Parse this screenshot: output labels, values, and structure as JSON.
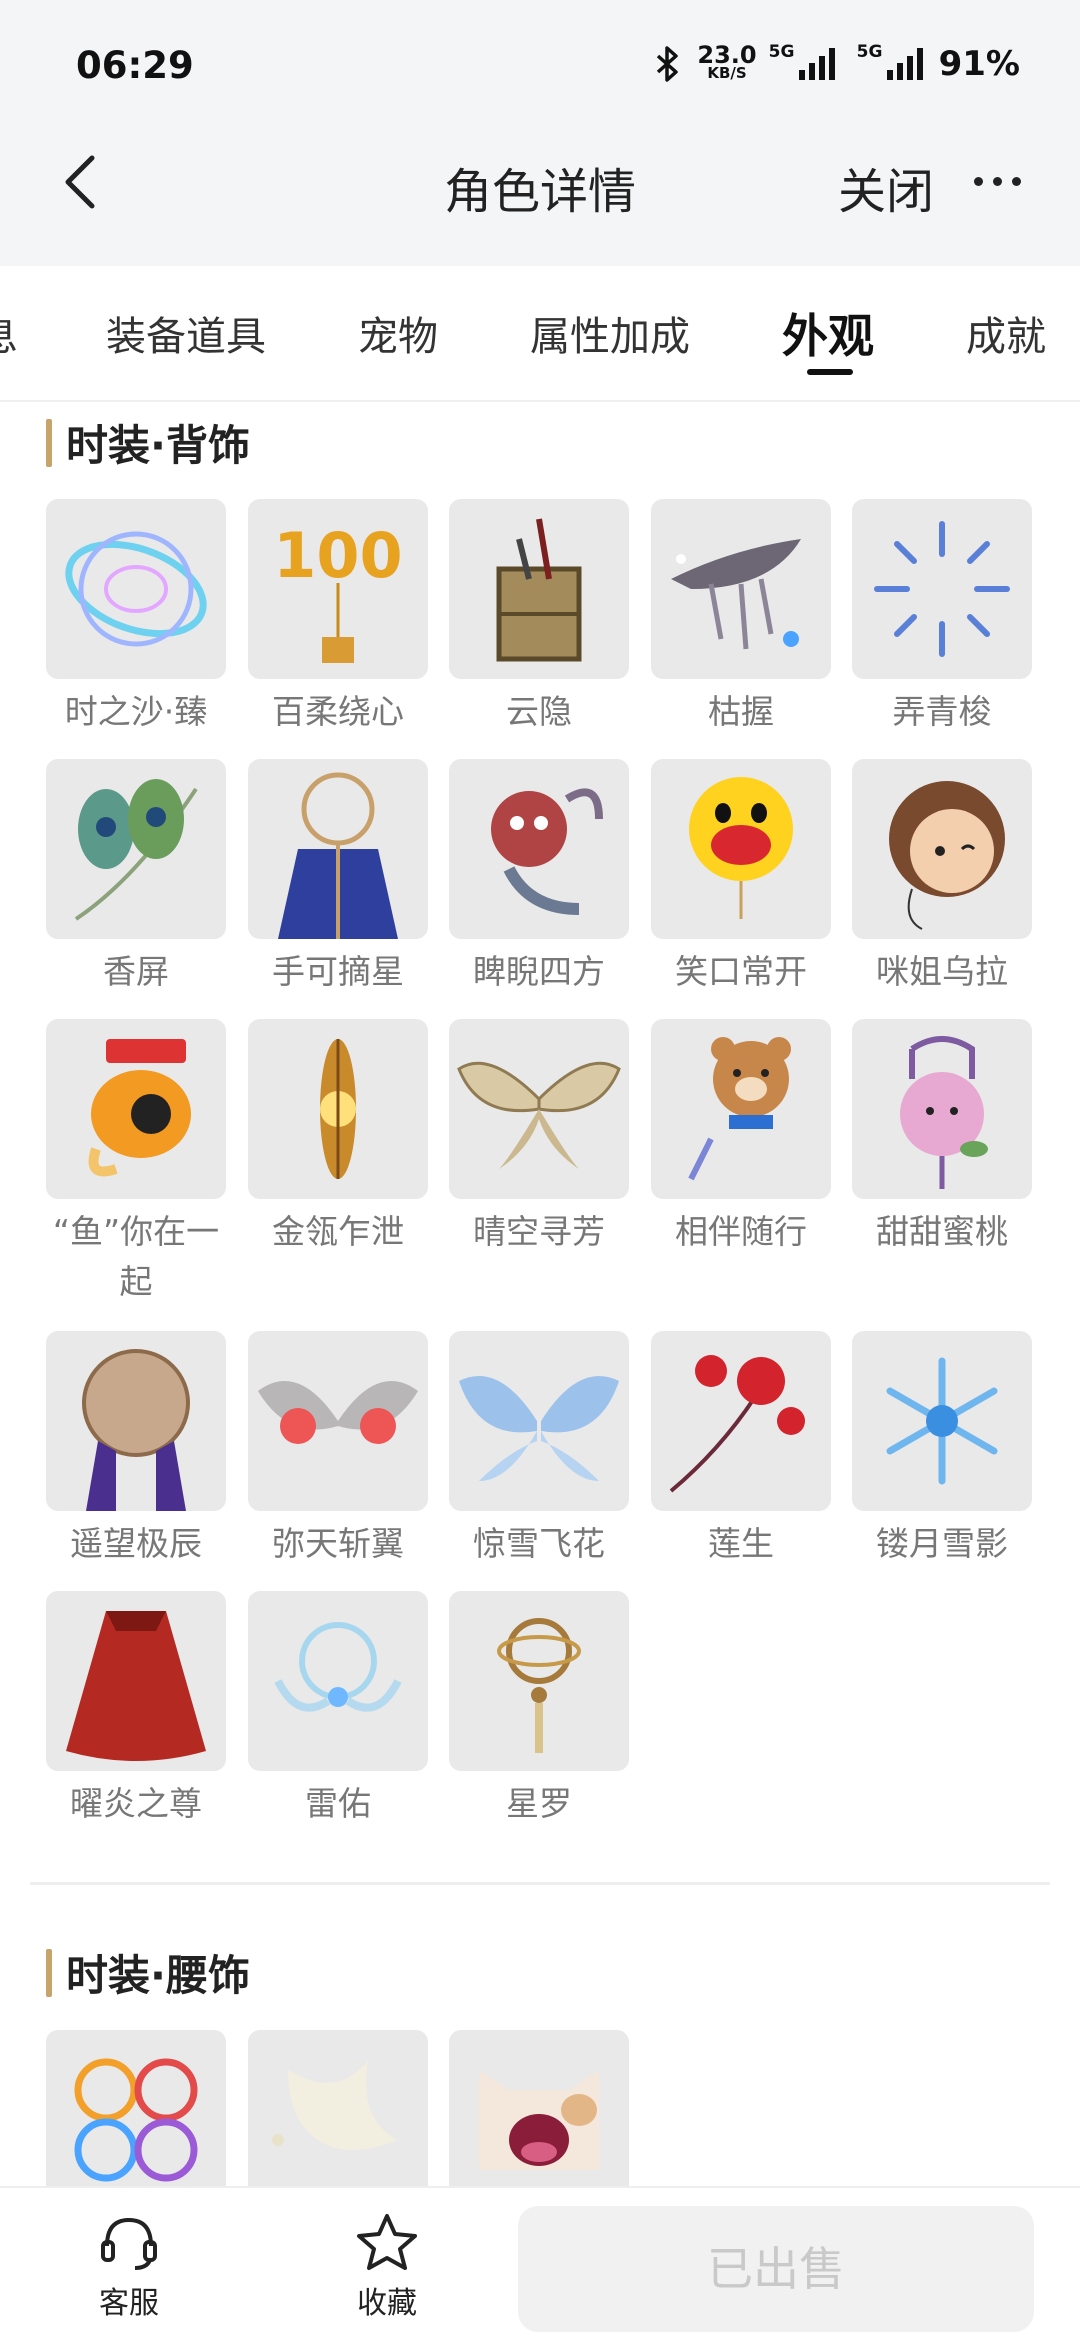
{
  "status_bar": {
    "time": "06:29",
    "net_speed_value": "23.0",
    "net_speed_unit": "KB/S",
    "sim1_type": "5G",
    "sim2_type": "5G",
    "battery": "91%"
  },
  "header": {
    "title": "角色详情",
    "close_label": "关闭"
  },
  "tabs": [
    {
      "label": "息"
    },
    {
      "label": "装备道具"
    },
    {
      "label": "宠物"
    },
    {
      "label": "属性加成"
    },
    {
      "label": "外观",
      "active": true
    },
    {
      "label": "成就"
    }
  ],
  "sections": [
    {
      "title": "时装·背饰",
      "items": [
        {
          "name": "时之沙·臻",
          "icon": "ring-icon"
        },
        {
          "name": "百柔绕心",
          "icon": "balloon-100-icon"
        },
        {
          "name": "云隐",
          "icon": "basket-icon"
        },
        {
          "name": "枯握",
          "icon": "branch-icon"
        },
        {
          "name": "弄青梭",
          "icon": "sparkle-ring-icon"
        },
        {
          "name": "香屏",
          "icon": "peacock-feather-icon"
        },
        {
          "name": "手可摘星",
          "icon": "dreamcatcher-cape-icon"
        },
        {
          "name": "睥睨四方",
          "icon": "demon-icon"
        },
        {
          "name": "笑口常开",
          "icon": "smiley-balloon-icon"
        },
        {
          "name": "咪姐乌拉",
          "icon": "girl-balloon-icon"
        },
        {
          "name": "“鱼”你在一起",
          "icon": "fish-icon"
        },
        {
          "name": "金瓴乍泄",
          "icon": "golden-feather-icon"
        },
        {
          "name": "晴空寻芳",
          "icon": "butterfly-wings-icon"
        },
        {
          "name": "相伴随行",
          "icon": "bear-balloon-icon"
        },
        {
          "name": "甜甜蜜桃",
          "icon": "peach-icon"
        },
        {
          "name": "遥望极辰",
          "icon": "moon-cape-icon"
        },
        {
          "name": "弥天斩翼",
          "icon": "red-wings-icon"
        },
        {
          "name": "惊雪飞花",
          "icon": "blue-wings-icon"
        },
        {
          "name": "莲生",
          "icon": "red-flower-icon"
        },
        {
          "name": "镂月雪影",
          "icon": "snowflake-icon"
        },
        {
          "name": "曜炎之尊",
          "icon": "red-cape-icon"
        },
        {
          "name": "雷佑",
          "icon": "halo-icon"
        },
        {
          "name": "星罗",
          "icon": "astrolabe-icon"
        }
      ]
    },
    {
      "title": "时装·腰饰",
      "items": [
        {
          "name": "",
          "icon": "rings-icon"
        },
        {
          "name": "",
          "icon": "dove-icon"
        },
        {
          "name": "",
          "icon": "cat-icon"
        }
      ]
    }
  ],
  "bottom_bar": {
    "service_label": "客服",
    "favorite_label": "收藏",
    "sold_label": "已出售"
  }
}
